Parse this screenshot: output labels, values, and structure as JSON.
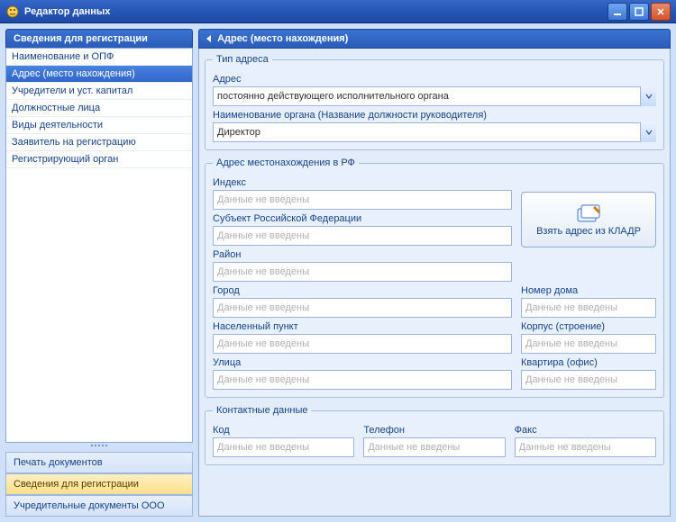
{
  "window": {
    "title": "Редактор данных"
  },
  "sidebar": {
    "header": "Сведения для регистрации",
    "items": [
      {
        "label": "Наименование и ОПФ"
      },
      {
        "label": "Адрес (место нахождения)"
      },
      {
        "label": "Учредители и уст. капитал"
      },
      {
        "label": "Должностные лица"
      },
      {
        "label": "Виды деятельности"
      },
      {
        "label": "Заявитель на регистрацию"
      },
      {
        "label": "Регистрирующий орган"
      }
    ],
    "selected_index": 1
  },
  "accordion": {
    "items": [
      {
        "label": "Печать документов"
      },
      {
        "label": "Сведения для регистрации"
      },
      {
        "label": "Учредительные документы ООО"
      }
    ],
    "active_index": 1
  },
  "main": {
    "header": "Адрес (место нахождения)",
    "groups": {
      "type": {
        "legend": "Тип адреса",
        "address_label": "Адрес",
        "address_value": "постоянно действующего исполнительного органа",
        "org_label": "Наименование органа (Название должности руководителя)",
        "org_value": "Директор"
      },
      "rf": {
        "legend": "Адрес местонахождения в РФ",
        "index_label": "Индекс",
        "subject_label": "Субъект Российской Федерации",
        "district_label": "Район",
        "city_label": "Город",
        "settlement_label": "Населенный пункт",
        "street_label": "Улица",
        "house_label": "Номер дома",
        "building_label": "Корпус (строение)",
        "apartment_label": "Квартира (офис)",
        "placeholder": "Данные не введены",
        "kladr_button": "Взять адрес из КЛАДР"
      },
      "contact": {
        "legend": "Контактные данные",
        "code_label": "Код",
        "phone_label": "Телефон",
        "fax_label": "Факс",
        "placeholder": "Данные не введены"
      }
    }
  }
}
